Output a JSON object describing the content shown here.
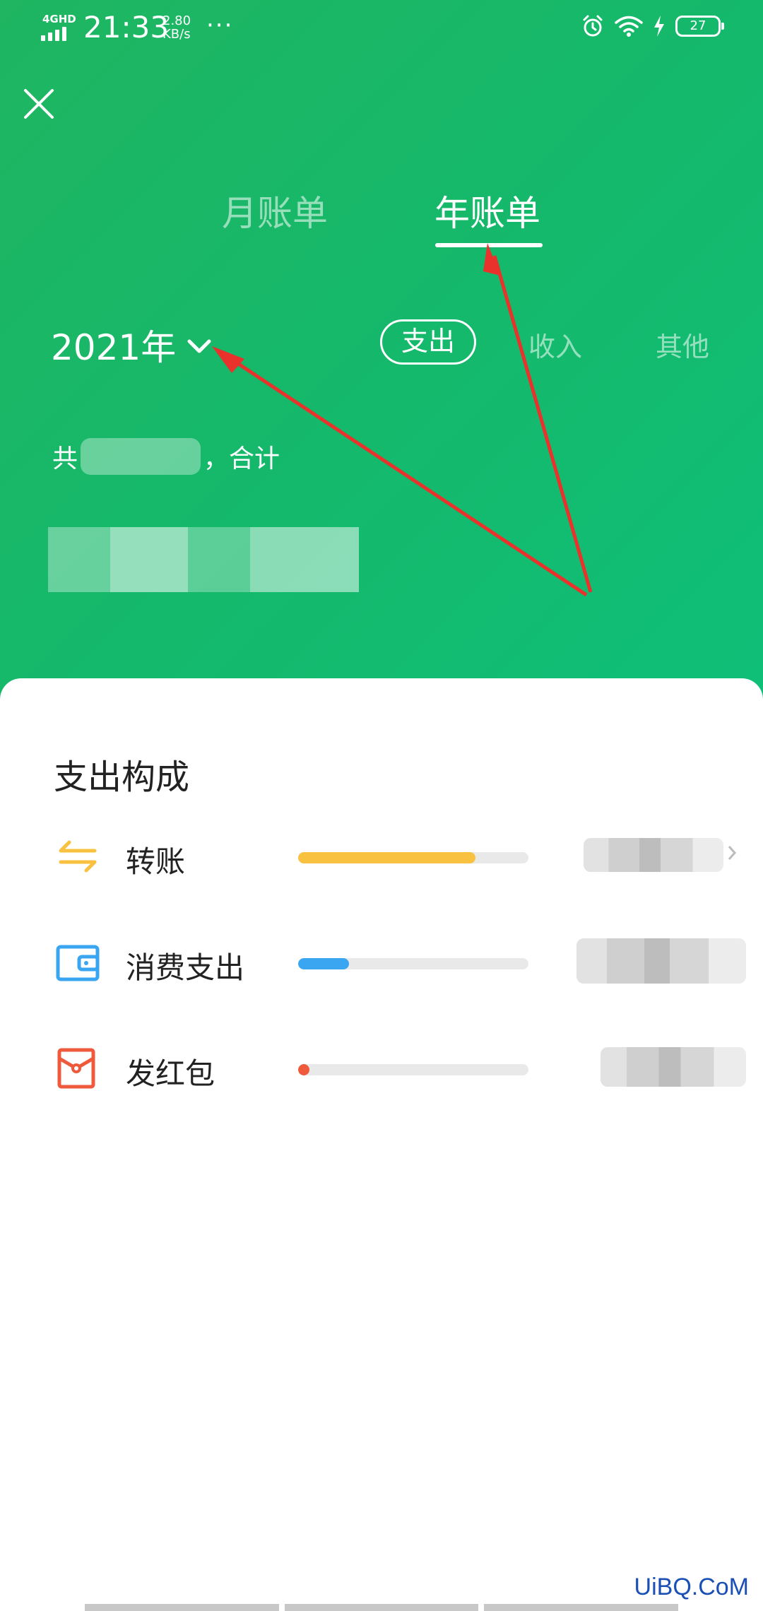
{
  "status_bar": {
    "network": "4GHD",
    "time": "21:33",
    "speed_value": "2.80",
    "speed_unit": "KB/s",
    "more": "···",
    "battery": "27"
  },
  "tabs": {
    "month": "月账单",
    "year": "年账单",
    "active": "year"
  },
  "filter": {
    "year": "2021年",
    "types": {
      "expense": "支出",
      "income": "收入",
      "other": "其他"
    },
    "selected_type": "expense"
  },
  "summary": {
    "prefix": "共",
    "separator": "，合计"
  },
  "breakdown": {
    "title": "支出构成",
    "items": [
      {
        "label": "转账",
        "icon": "transfer-icon",
        "fraction": 0.77,
        "color": "#f8c140"
      },
      {
        "label": "消费支出",
        "icon": "wallet-icon",
        "fraction": 0.22,
        "color": "#3aa6f2"
      },
      {
        "label": "发红包",
        "icon": "red-packet-icon",
        "fraction": 0.04,
        "color": "#ee5a3b"
      }
    ]
  },
  "theme": {
    "header_green": "#18b865",
    "transfer_color": "#f8c140",
    "wallet_color": "#3aa6f2",
    "red_packet_color": "#ee5a3b"
  },
  "watermark": "UiBQ.CoM"
}
